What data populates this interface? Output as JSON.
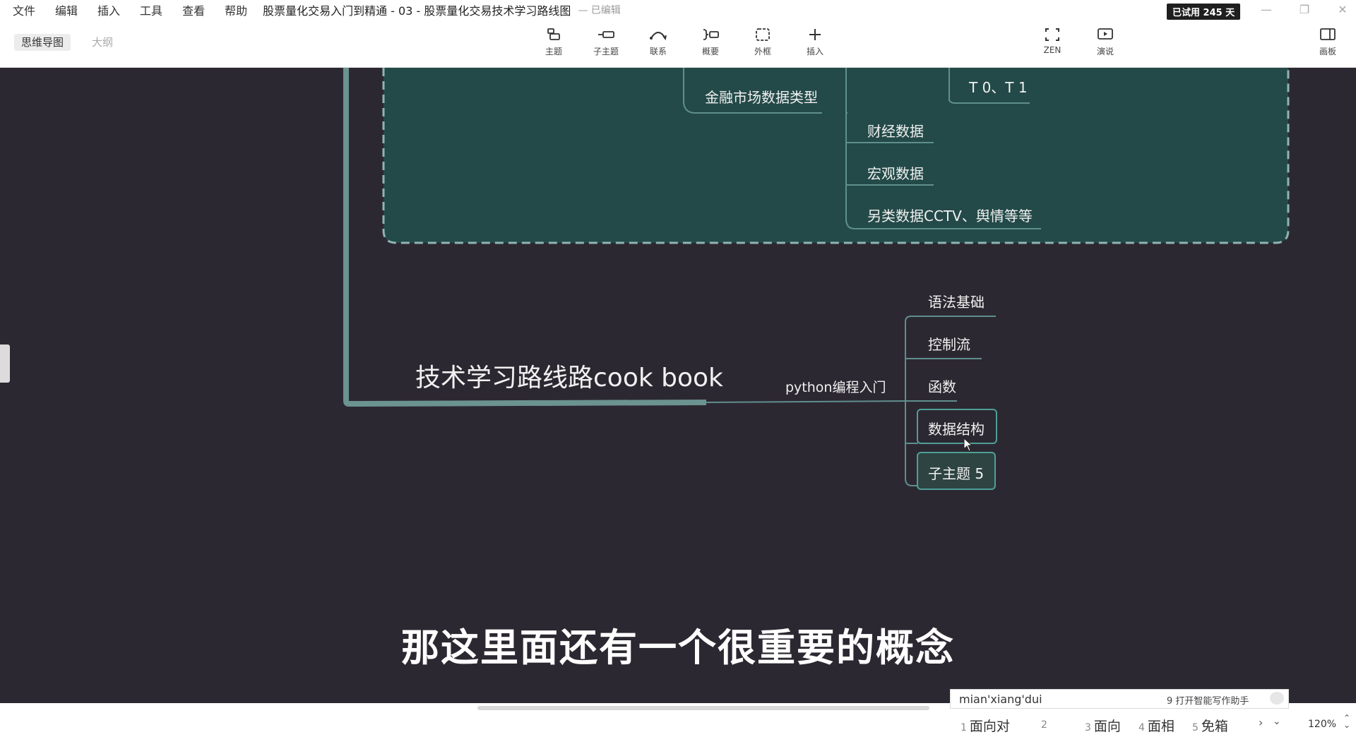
{
  "menu": [
    "文件",
    "编辑",
    "插入",
    "工具",
    "查看",
    "帮助"
  ],
  "document_title": "股票量化交易入门到精通 - 03 - 股票量化交易技术学习路线图",
  "document_state": "— 已编辑",
  "trial_badge": "已试用 245 天",
  "view_tabs": {
    "mindmap": "思维导图",
    "outline": "大纲"
  },
  "tools": [
    {
      "label": "主题",
      "icon": "topic-icon"
    },
    {
      "label": "子主题",
      "icon": "subtopic-icon"
    },
    {
      "label": "联系",
      "icon": "relationship-icon"
    },
    {
      "label": "概要",
      "icon": "summary-icon"
    },
    {
      "label": "外框",
      "icon": "boundary-icon"
    },
    {
      "label": "插入",
      "icon": "plus-icon"
    }
  ],
  "right_tools": [
    {
      "label": "ZEN",
      "icon": "fullscreen-icon"
    },
    {
      "label": "演说",
      "icon": "play-icon"
    },
    {
      "label": "画板",
      "icon": "panel-icon"
    }
  ],
  "mindmap": {
    "boundary_nodes": {
      "market_data_types": "金融市场数据类型",
      "t0_t1": "T 0、T 1",
      "financial": "财经数据",
      "macro": "宏观数据",
      "alternative": "另类数据CCTV、舆情等等"
    },
    "central_topic": "技术学习路线路cook book",
    "python_branch": "python编程入门",
    "python_children": [
      "语法基础",
      "控制流",
      "函数",
      "数据结构",
      "子主题 5"
    ]
  },
  "subtitle": "那这里面还有一个很重要的概念",
  "ime": {
    "composition": "mian'xiang'dui",
    "assistant": "9 打开智能写作助手",
    "candidates": [
      {
        "num": "1",
        "text": "面向对"
      },
      {
        "num": "2",
        "text": ""
      },
      {
        "num": "3",
        "text": "面向"
      },
      {
        "num": "4",
        "text": "面相"
      },
      {
        "num": "5",
        "text": "免箱"
      }
    ]
  },
  "zoom": "120%",
  "colors": {
    "canvas": "#2c2831",
    "boundary_fill": "#234a48",
    "boundary_stroke": "#8fb5b0",
    "branch": "#5f8f8c",
    "selection": "#4f9f98"
  }
}
